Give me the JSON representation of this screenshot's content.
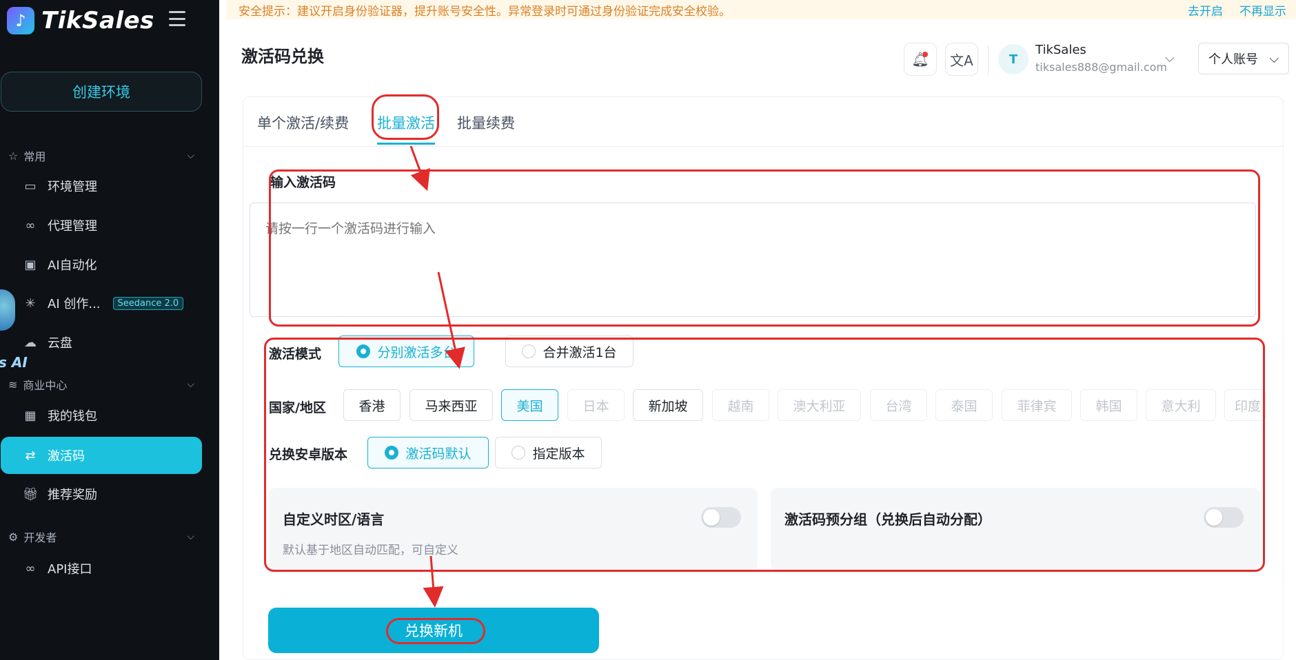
{
  "app": {
    "logo_text": "TikSales"
  },
  "sidebar": {
    "create_button": "创建环境",
    "section_common": "常用",
    "section_business": "商业中心",
    "section_dev": "开发者",
    "items": [
      {
        "label": "环境管理",
        "icon": "monitor-icon"
      },
      {
        "label": "代理管理",
        "icon": "link-icon"
      },
      {
        "label": "AI自动化",
        "icon": "automation-icon"
      },
      {
        "label": "AI 创作...",
        "icon": "sparkle-icon",
        "badge": "Seedance 2.0"
      },
      {
        "label": "云盘",
        "icon": "cloud-icon"
      },
      {
        "label": "我的钱包",
        "icon": "wallet-icon"
      },
      {
        "label": "激活码",
        "icon": "exchange-icon",
        "active": true
      },
      {
        "label": "推荐奖励",
        "icon": "gift-icon"
      },
      {
        "label": "API接口",
        "icon": "api-icon"
      }
    ],
    "robot_text": "s AI"
  },
  "notice": {
    "text": "安全提示：建议开启身份验证器，提升账号安全性。异常登录时可通过身份验证完成安全校验。",
    "enable_link": "去开启",
    "dismiss_link": "不再显示"
  },
  "header": {
    "title": "激活码兑换",
    "user_initial": "T",
    "user_name": "TikSales",
    "user_email": "tiksales888@gmail.com",
    "account_select": "个人账号"
  },
  "tabs": [
    "单个激活/续费",
    "批量激活",
    "批量续费"
  ],
  "form": {
    "codes_label": "输入激活码",
    "codes_placeholder": "请按一行一个激活码进行输入",
    "mode_label": "激活模式",
    "mode_options": [
      "分别激活多台",
      "合并激活1台"
    ],
    "region_label": "国家/地区",
    "regions": [
      "香港",
      "马来西亚",
      "美国",
      "日本",
      "新加坡",
      "越南",
      "澳大利亚",
      "台湾",
      "泰国",
      "菲律宾",
      "韩国",
      "意大利",
      "印度"
    ],
    "selected_region": "美国",
    "version_label": "兑换安卓版本",
    "version_options": [
      "激活码默认",
      "指定版本"
    ],
    "custom_tz_title": "自定义时区/语言",
    "custom_tz_desc": "默认基于地区自动匹配，可自定义",
    "pregroup_title": "激活码预分组（兑换后自动分配）",
    "submit": "兑换新机"
  },
  "colors": {
    "accent": "#1ab1d3",
    "annotation": "#e22b2b",
    "sidebar_bg": "#0e1116"
  }
}
